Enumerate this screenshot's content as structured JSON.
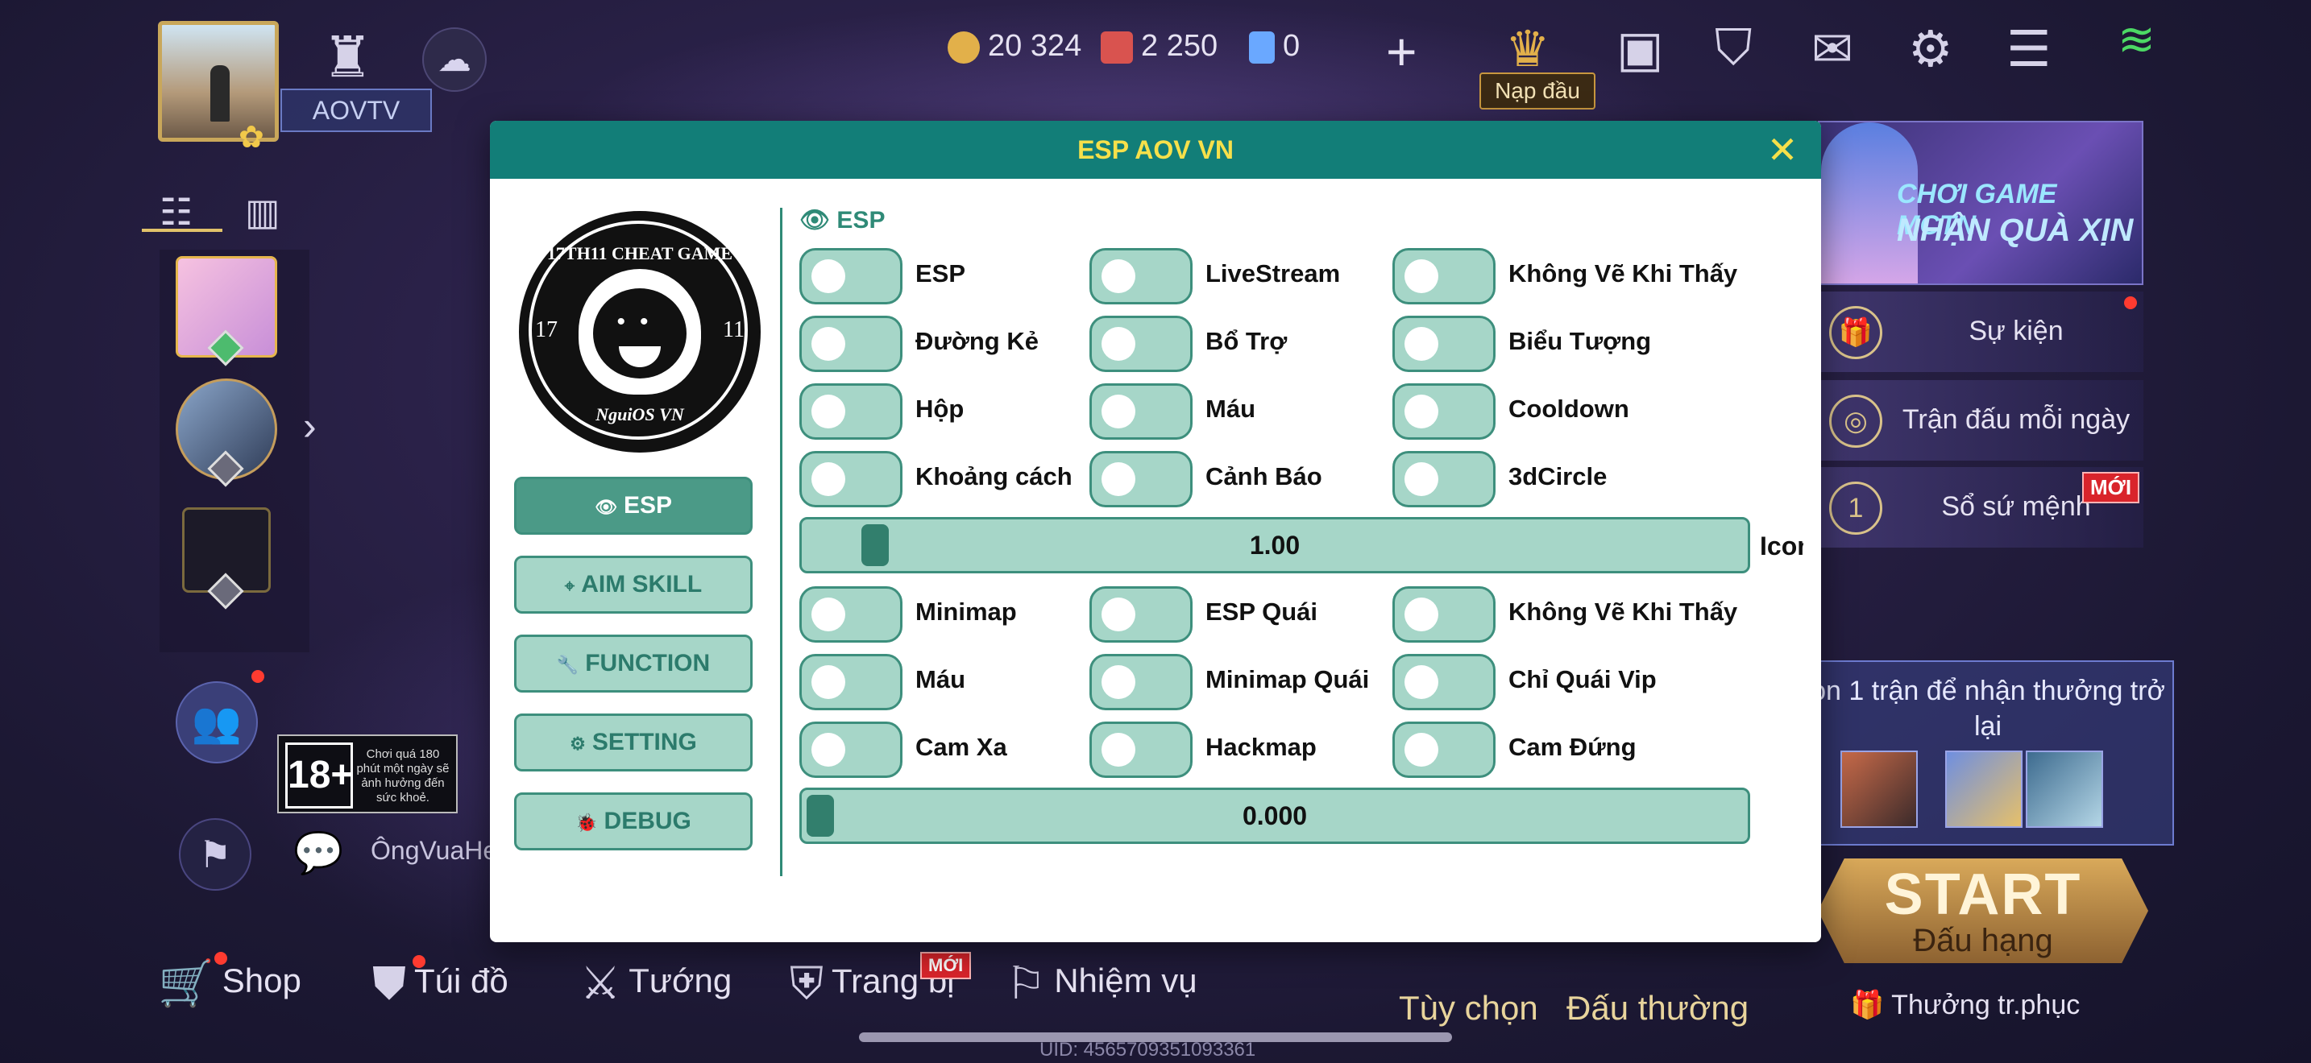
{
  "game": {
    "player_name": "AOVTV",
    "currencies": [
      {
        "icon": "gold-coin-icon",
        "value": "20 324",
        "color": "#e2b04a"
      },
      {
        "icon": "red-voucher-icon",
        "value": "2 250",
        "color": "#d9534f"
      },
      {
        "icon": "blue-coupon-icon",
        "value": "0",
        "color": "#6aa8ff"
      }
    ],
    "topup_label": "Nạp đầu",
    "rating_badge": "18+",
    "rating_note": "Chơi quá 180 phút một ngày sẽ ảnh hưởng đến sức khoẻ.",
    "chat_name": "ÔngVuaHe",
    "side_banner": {
      "line1": "CHƠI GAME MCTN",
      "line2": "NHẬN QUÀ XỊN"
    },
    "right_items": [
      {
        "icon": "event-icon",
        "label": "Sự kiện"
      },
      {
        "icon": "daily-match-icon",
        "label": "Trận đấu mỗi ngày"
      },
      {
        "icon": "mission-book-icon",
        "label": "Sổ sứ mệnh",
        "badge": "MỚI"
      }
    ],
    "win_reward_text": "on 1 trận để nhận thưởng trở lại",
    "start": {
      "title": "START",
      "mode": "Đấu hạng"
    },
    "reward_label": "Thưởng tr.phục",
    "bottom_nav": [
      {
        "icon": "shop-icon",
        "label": "Shop"
      },
      {
        "icon": "bag-icon",
        "label": "Túi đồ"
      },
      {
        "icon": "hero-icon",
        "label": "Tướng"
      },
      {
        "icon": "equipment-icon",
        "label": "Trang bị",
        "badge": "MỚI"
      },
      {
        "icon": "quest-icon",
        "label": "Nhiệm vụ"
      }
    ],
    "modes": [
      "Tùy chọn",
      "Đấu thường"
    ],
    "uid": "UID: 4565709351093361"
  },
  "modal": {
    "title": "ESP AOV VN",
    "close": "✕",
    "logo": {
      "top": "17TH11 CHEAT GAME",
      "bottom": "NguiOS VN",
      "left_num": "17",
      "right_num": "11"
    },
    "menu": [
      {
        "id": "esp",
        "icon": "👁",
        "label": "ESP",
        "active": true
      },
      {
        "id": "aim",
        "icon": "⌖",
        "label": "AIM SKILL",
        "active": false
      },
      {
        "id": "function",
        "icon": "🔧",
        "label": "FUNCTION",
        "active": false
      },
      {
        "id": "setting",
        "icon": "⚙",
        "label": "SETTING",
        "active": false
      },
      {
        "id": "debug",
        "icon": "🐞",
        "label": "DEBUG",
        "active": false
      }
    ],
    "section_title": "👁 ESP",
    "toggle_rows_1": [
      [
        "ESP",
        "LiveStream",
        "Không Vẽ Khi Thấy"
      ],
      [
        "Đường Kẻ",
        "Bổ Trợ",
        "Biểu Tượng"
      ],
      [
        "Hộp",
        "Máu",
        "Cooldown"
      ],
      [
        "Khoảng cách",
        "Cảnh Báo",
        "3dCircle"
      ]
    ],
    "slider_1": {
      "value": "1.00",
      "side_label": "Icon",
      "fraction": 0.06
    },
    "toggle_rows_2": [
      [
        "Minimap",
        "ESP Quái",
        "Không Vẽ Khi Thấy"
      ],
      [
        "Máu",
        "Minimap Quái",
        "Chỉ Quái Vip"
      ],
      [
        "Cam Xa",
        "Hackmap",
        "Cam Đứng"
      ]
    ],
    "slider_2": {
      "value": "0.000",
      "fraction": 0.0
    },
    "accent": "#127e78",
    "title_color": "#f6e04a"
  }
}
